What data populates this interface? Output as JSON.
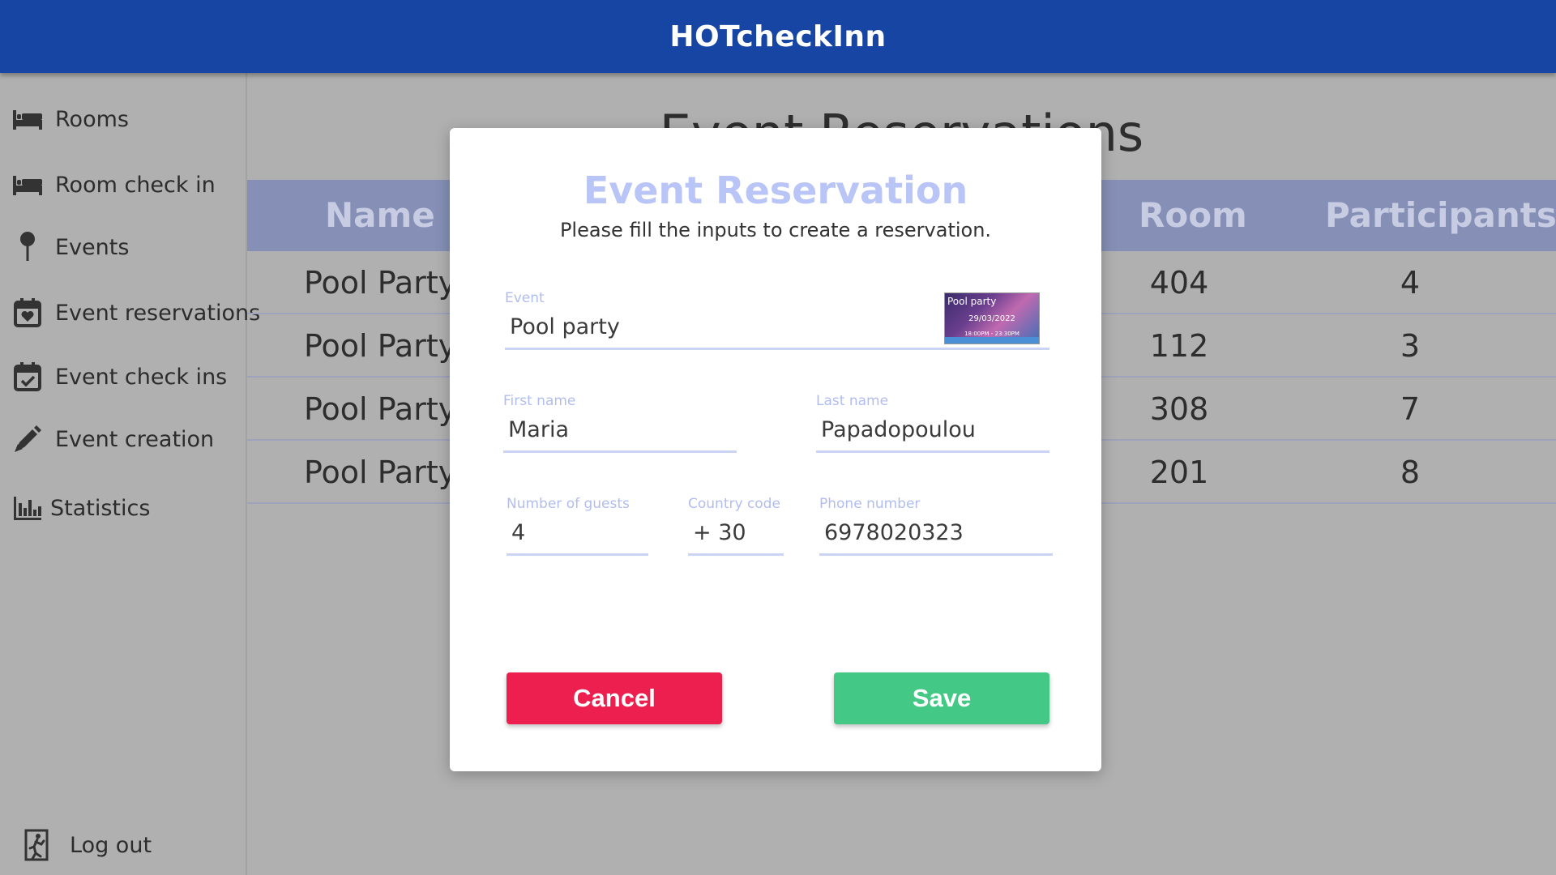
{
  "app": {
    "title": "HOTcheckInn"
  },
  "sidebar": {
    "items": [
      {
        "label": "Rooms",
        "icon": "bed-icon"
      },
      {
        "label": "Room check in",
        "icon": "bed-icon"
      },
      {
        "label": "Events",
        "icon": "map-pin-icon"
      },
      {
        "label": "Event reservations",
        "icon": "calendar-heart-icon"
      },
      {
        "label": "Event check ins",
        "icon": "calendar-check-icon"
      },
      {
        "label": "Event creation",
        "icon": "pencil-icon"
      },
      {
        "label": "Statistics",
        "icon": "bar-chart-icon"
      }
    ],
    "logout": {
      "label": "Log out",
      "icon": "exit-icon"
    }
  },
  "page": {
    "heading": "Event Reservations",
    "table": {
      "columns": [
        "Name",
        "Room",
        "Participants"
      ],
      "rows": [
        {
          "name": "Pool Party",
          "room": "404",
          "participants": "4"
        },
        {
          "name": "Pool Party",
          "room": "112",
          "participants": "3"
        },
        {
          "name": "Pool Party",
          "room": "308",
          "participants": "7"
        },
        {
          "name": "Pool Party",
          "room": "201",
          "participants": "8"
        }
      ]
    }
  },
  "modal": {
    "title": "Event Reservation",
    "subtitle": "Please fill the inputs to create a reservation.",
    "event": {
      "label": "Event",
      "value": "Pool party",
      "thumbnail": {
        "title": "Pool party",
        "date": "29/03/2022",
        "time": "18:00PM - 23:30PM"
      }
    },
    "first_name": {
      "label": "First name",
      "value": "Maria"
    },
    "last_name": {
      "label": "Last name",
      "value": "Papadopoulou"
    },
    "guests": {
      "label": "Number of guests",
      "value": "4"
    },
    "country_code": {
      "label": "Country code",
      "value": "+ 30"
    },
    "phone": {
      "label": "Phone number",
      "value": "6978020323"
    },
    "cancel_label": "Cancel",
    "save_label": "Save"
  },
  "colors": {
    "topbar": "#1645a3",
    "cancel": "#ec1f4e",
    "save": "#44c886",
    "accent_light": "#b8c5f6"
  }
}
